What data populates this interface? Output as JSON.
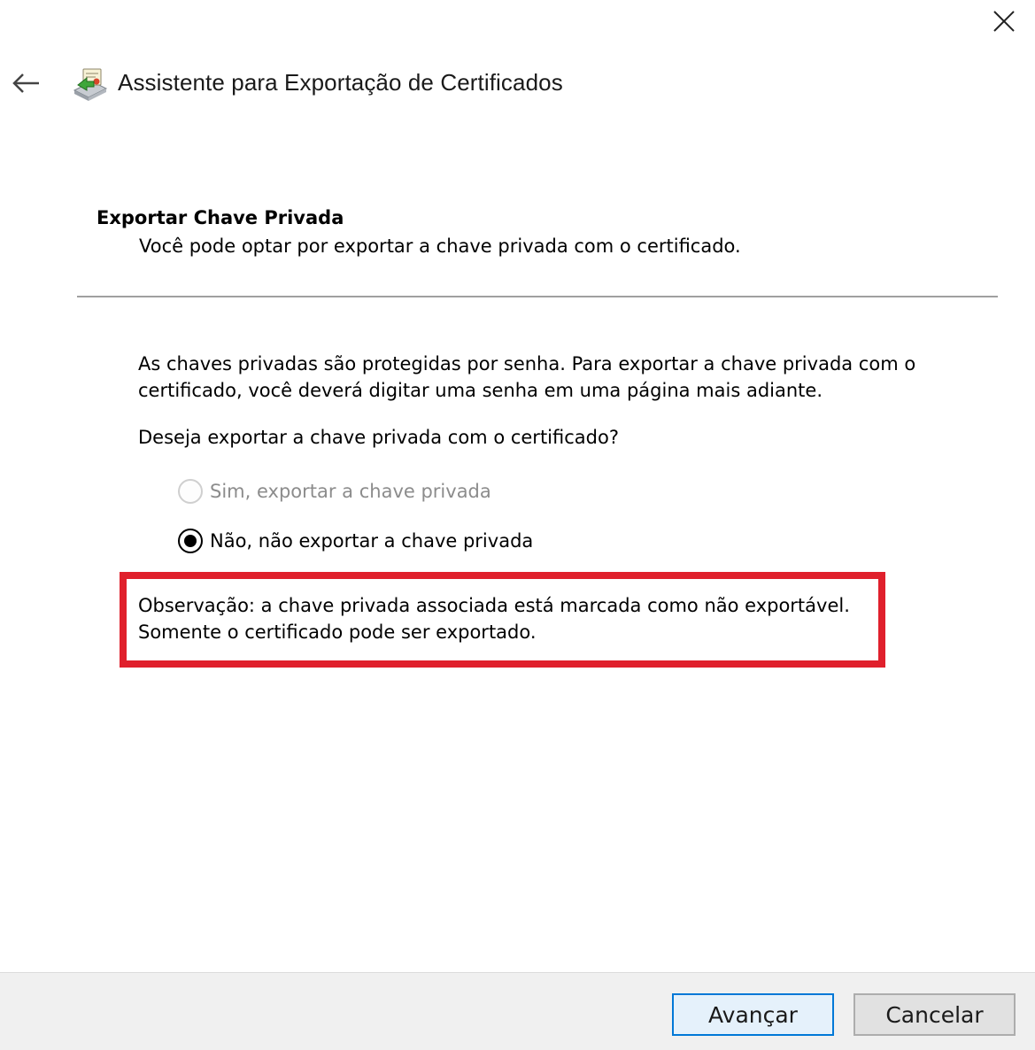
{
  "window": {
    "title": "Assistente para Exportação de Certificados",
    "close_icon": "close-icon",
    "back_icon": "back-arrow-icon",
    "wizard_icon": "certificate-wizard-icon"
  },
  "page": {
    "heading": "Exportar Chave Privada",
    "subheading": "Você pode optar por exportar a chave privada com o certificado.",
    "description": "As chaves privadas são protegidas por senha. Para exportar a chave privada com o certificado, você deverá digitar uma senha em uma página mais adiante.",
    "question": "Deseja exportar a chave privada com o certificado?"
  },
  "options": [
    {
      "label": "Sim, exportar a chave privada",
      "selected": false,
      "enabled": false
    },
    {
      "label": "Não, não exportar a chave privada",
      "selected": true,
      "enabled": true
    }
  ],
  "note": {
    "line1": "Observação: a chave privada associada está marcada como não exportável.",
    "line2": "Somente o certificado pode ser exportado.",
    "highlight_color": "#e0202c"
  },
  "footer": {
    "next_label": "Avançar",
    "cancel_label": "Cancelar"
  },
  "colors": {
    "accent": "#0078d7",
    "footer_bg": "#f0f0f0"
  }
}
